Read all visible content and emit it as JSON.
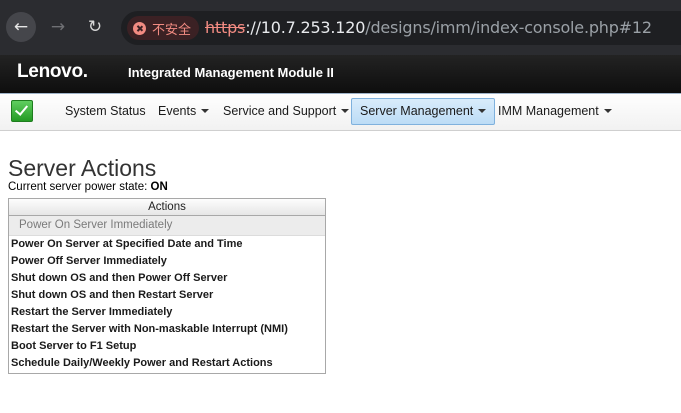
{
  "browser": {
    "back_icon": "arrow-left-icon",
    "forward_icon": "arrow-right-icon",
    "reload_icon": "reload-icon",
    "security_label": "不安全",
    "url_scheme": "https",
    "url_host": "://10.7.253.120",
    "url_path": "/designs/imm/index-console.php#12"
  },
  "header": {
    "logo": "Lenovo.",
    "product_title": "Integrated Management Module II"
  },
  "menu": {
    "status_icon": "checkmark-icon",
    "status_color": "#2ea82e",
    "items": [
      {
        "label": "System Status",
        "has_dropdown": false
      },
      {
        "label": "Events",
        "has_dropdown": true
      },
      {
        "label": "Service and Support",
        "has_dropdown": true
      },
      {
        "label": "Server Management",
        "has_dropdown": true,
        "active": true
      },
      {
        "label": "IMM Management",
        "has_dropdown": true
      }
    ]
  },
  "main": {
    "title": "Server Actions",
    "power_state_label": "Current server power state:",
    "power_state_value": "ON",
    "actions_header": "Actions",
    "actions": [
      "Power On Server Immediately",
      "Power On Server at Specified Date and Time",
      "Power Off Server Immediately",
      "Shut down OS and then Power Off Server",
      "Shut down OS and then Restart Server",
      "Restart the Server Immediately",
      "Restart the Server with Non-maskable Interrupt (NMI)",
      "Boot Server to F1 Setup",
      "Schedule Daily/Weekly Power and Restart Actions"
    ]
  }
}
